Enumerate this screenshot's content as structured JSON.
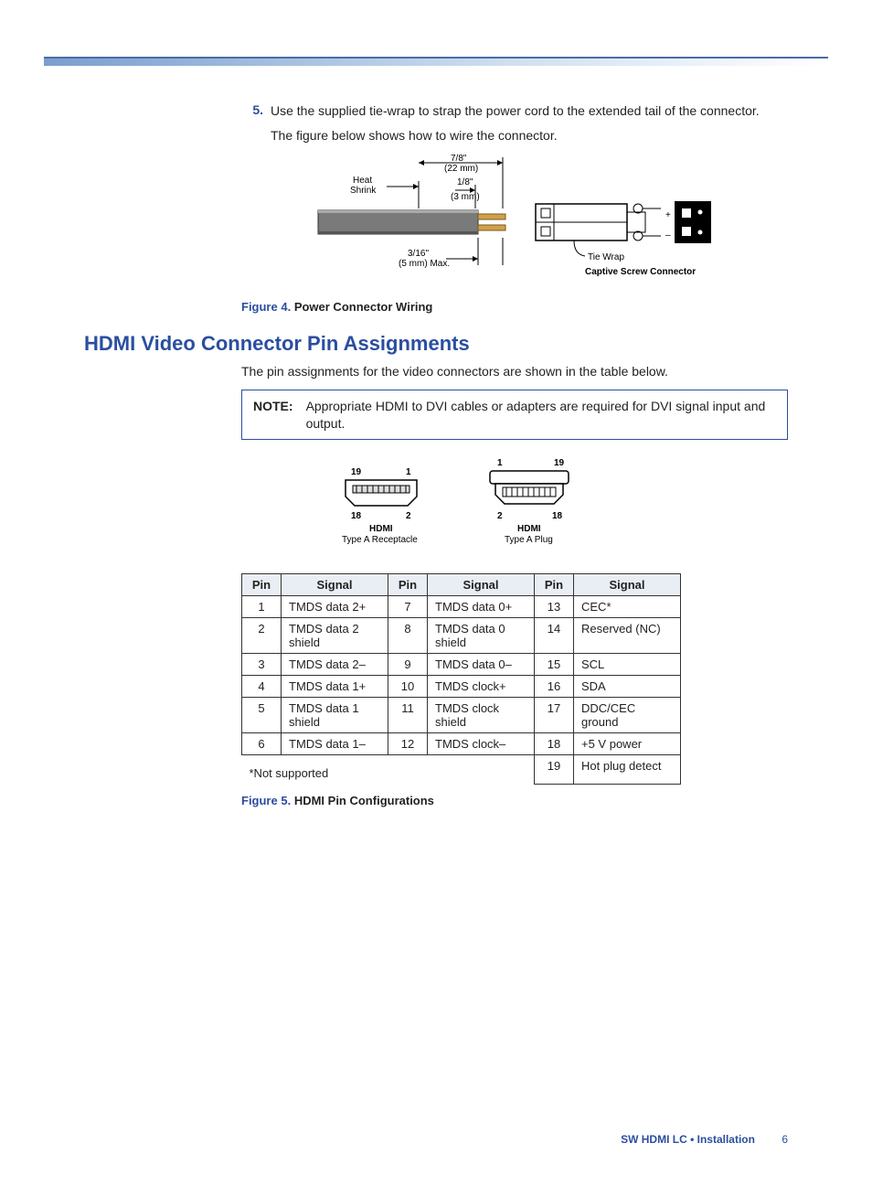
{
  "step": {
    "number": "5.",
    "text1": "Use the supplied tie-wrap to strap the power cord to the extended tail of the connector.",
    "text2": "The figure below shows how to wire the connector."
  },
  "figure4": {
    "label": "Figure 4.",
    "title": "Power Connector Wiring",
    "labels": {
      "heat": "Heat",
      "shrink": "Shrink",
      "w78": "7/8\"",
      "mm22": "(22 mm)",
      "w18": "1/8\"",
      "mm3": "(3 mm)",
      "w316": "3/16\"",
      "mm5max": "(5 mm) Max.",
      "tiewrap": "Tie Wrap",
      "captive": "Captive Screw Connector"
    }
  },
  "section_title": "HDMI Video Connector Pin Assignments",
  "intro": "The pin assignments for the video connectors are shown in the table below.",
  "note": {
    "label": "NOTE:",
    "text": "Appropriate HDMI to DVI cables or adapters are required for DVI signal input and output."
  },
  "connectors": {
    "recept": {
      "p19": "19",
      "p1": "1",
      "p18": "18",
      "p2": "2",
      "name": "HDMI",
      "type": "Type A Receptacle"
    },
    "plug": {
      "p1": "1",
      "p19": "19",
      "p2": "2",
      "p18": "18",
      "name": "HDMI",
      "type": "Type A Plug"
    }
  },
  "table": {
    "headers": {
      "pin": "Pin",
      "signal": "Signal"
    },
    "cols": [
      [
        {
          "pin": "1",
          "sig": "TMDS data 2+"
        },
        {
          "pin": "2",
          "sig": "TMDS data 2 shield"
        },
        {
          "pin": "3",
          "sig": "TMDS data 2–"
        },
        {
          "pin": "4",
          "sig": "TMDS data 1+"
        },
        {
          "pin": "5",
          "sig": "TMDS data 1 shield"
        },
        {
          "pin": "6",
          "sig": "TMDS data 1–"
        }
      ],
      [
        {
          "pin": "7",
          "sig": "TMDS data 0+"
        },
        {
          "pin": "8",
          "sig": "TMDS data 0 shield"
        },
        {
          "pin": "9",
          "sig": "TMDS data 0–"
        },
        {
          "pin": "10",
          "sig": "TMDS clock+"
        },
        {
          "pin": "11",
          "sig": "TMDS clock shield"
        },
        {
          "pin": "12",
          "sig": "TMDS clock–"
        }
      ],
      [
        {
          "pin": "13",
          "sig": "CEC*"
        },
        {
          "pin": "14",
          "sig": "Reserved (NC)"
        },
        {
          "pin": "15",
          "sig": "SCL"
        },
        {
          "pin": "16",
          "sig": "SDA"
        },
        {
          "pin": "17",
          "sig": "DDC/CEC ground"
        },
        {
          "pin": "18",
          "sig": "+5 V power"
        },
        {
          "pin": "19",
          "sig": "Hot plug detect"
        }
      ]
    ],
    "not_supported": "*Not supported"
  },
  "figure5": {
    "label": "Figure 5.",
    "title": "HDMI Pin Configurations"
  },
  "footer": {
    "doc": "SW HDMI LC • Installation",
    "page": "6"
  }
}
